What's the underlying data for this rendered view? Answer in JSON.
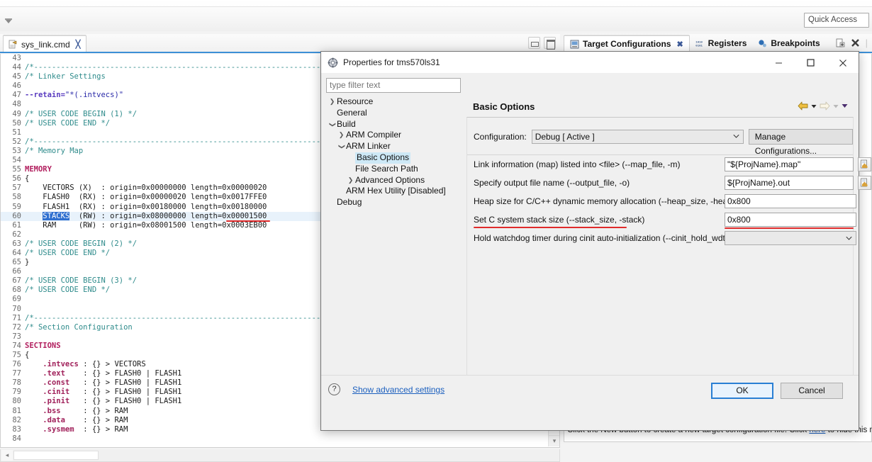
{
  "topbar": {
    "quick_access": "Quick Access",
    "menu_arrow_icon": "toolbar-overflow-icon"
  },
  "editor": {
    "tab": {
      "label": "sys_link.cmd",
      "icon": "linker-script-file-icon",
      "close_icon": "close-tab-icon"
    },
    "minimize_icon": "minimize-icon",
    "maximize_icon": "maximize-icon",
    "first_line_number": 43,
    "lines": [
      {
        "n": 43,
        "tokens": []
      },
      {
        "n": 44,
        "tokens": [
          {
            "t": "/*",
            "c": "c-comment"
          },
          {
            "t": "--------------------------------------------------------------------------------",
            "c": "dashline"
          }
        ]
      },
      {
        "n": 45,
        "tokens": [
          {
            "t": "/* Linker Settings",
            "c": "c-comment"
          }
        ]
      },
      {
        "n": 46,
        "tokens": []
      },
      {
        "n": 47,
        "tokens": [
          {
            "t": "--retain=",
            "c": "c-pre"
          },
          {
            "t": "\"*(.intvecs)\"",
            "c": "c-str"
          }
        ]
      },
      {
        "n": 48,
        "tokens": []
      },
      {
        "n": 49,
        "tokens": [
          {
            "t": "/* USER CODE BEGIN (1) */",
            "c": "c-comment"
          }
        ]
      },
      {
        "n": 50,
        "tokens": [
          {
            "t": "/* USER CODE END */",
            "c": "c-comment"
          }
        ]
      },
      {
        "n": 51,
        "tokens": []
      },
      {
        "n": 52,
        "tokens": [
          {
            "t": "/*",
            "c": "c-comment"
          },
          {
            "t": "--------------------------------------------------------------------------------",
            "c": "dashline"
          }
        ]
      },
      {
        "n": 53,
        "tokens": [
          {
            "t": "/* Memory Map",
            "c": "c-comment"
          }
        ]
      },
      {
        "n": 54,
        "tokens": []
      },
      {
        "n": 55,
        "tokens": [
          {
            "t": "MEMORY",
            "c": "c-keyword"
          }
        ]
      },
      {
        "n": 56,
        "tokens": [
          {
            "t": "{",
            "c": "c-plain"
          }
        ]
      },
      {
        "n": 57,
        "tokens": [
          {
            "t": "    VECTORS (X)  : origin=0x00000000 length=0x00000020",
            "c": "c-plain"
          }
        ]
      },
      {
        "n": 58,
        "tokens": [
          {
            "t": "    FLASH0  (RX) : origin=0x00000020 length=0x0017FFE0",
            "c": "c-plain"
          }
        ]
      },
      {
        "n": 59,
        "tokens": [
          {
            "t": "    FLASH1  (RX) : origin=0x00180000 length=0x00180000",
            "c": "c-plain"
          }
        ]
      },
      {
        "n": 60,
        "current": true,
        "tokens": [
          {
            "t": "    ",
            "c": "c-plain"
          },
          {
            "t": "STACKS",
            "c": "sel"
          },
          {
            "t": "  (RW) : origin=0x08000000 length=0x00001500",
            "c": "c-plain"
          }
        ]
      },
      {
        "n": 61,
        "tokens": [
          {
            "t": "    RAM     (RW) : origin=0x08001500 length=0x0003EB00",
            "c": "c-plain"
          }
        ]
      },
      {
        "n": 62,
        "tokens": []
      },
      {
        "n": 63,
        "tokens": [
          {
            "t": "/* USER CODE BEGIN (2) */",
            "c": "c-comment"
          }
        ]
      },
      {
        "n": 64,
        "tokens": [
          {
            "t": "/* USER CODE END */",
            "c": "c-comment"
          }
        ]
      },
      {
        "n": 65,
        "tokens": [
          {
            "t": "}",
            "c": "c-plain"
          }
        ]
      },
      {
        "n": 66,
        "tokens": []
      },
      {
        "n": 67,
        "tokens": [
          {
            "t": "/* USER CODE BEGIN (3) */",
            "c": "c-comment"
          }
        ]
      },
      {
        "n": 68,
        "tokens": [
          {
            "t": "/* USER CODE END */",
            "c": "c-comment"
          }
        ]
      },
      {
        "n": 69,
        "tokens": []
      },
      {
        "n": 70,
        "tokens": []
      },
      {
        "n": 71,
        "tokens": [
          {
            "t": "/*",
            "c": "c-comment"
          },
          {
            "t": "--------------------------------------------------------------------------------",
            "c": "dashline"
          }
        ]
      },
      {
        "n": 72,
        "tokens": [
          {
            "t": "/* Section Configuration",
            "c": "c-comment"
          }
        ]
      },
      {
        "n": 73,
        "tokens": []
      },
      {
        "n": 74,
        "tokens": [
          {
            "t": "SECTIONS",
            "c": "c-keyword"
          }
        ]
      },
      {
        "n": 75,
        "tokens": [
          {
            "t": "{",
            "c": "c-plain"
          }
        ]
      },
      {
        "n": 76,
        "tokens": [
          {
            "t": "    ",
            "c": "c-plain"
          },
          {
            "t": ".intvecs",
            "c": "c-sect"
          },
          {
            "t": " : {} > VECTORS",
            "c": "c-plain"
          }
        ]
      },
      {
        "n": 77,
        "tokens": [
          {
            "t": "    ",
            "c": "c-plain"
          },
          {
            "t": ".text",
            "c": "c-sect"
          },
          {
            "t": "    : {} > FLASH0 | FLASH1",
            "c": "c-plain"
          }
        ]
      },
      {
        "n": 78,
        "tokens": [
          {
            "t": "    ",
            "c": "c-plain"
          },
          {
            "t": ".const",
            "c": "c-sect"
          },
          {
            "t": "   : {} > FLASH0 | FLASH1",
            "c": "c-plain"
          }
        ]
      },
      {
        "n": 79,
        "tokens": [
          {
            "t": "    ",
            "c": "c-plain"
          },
          {
            "t": ".cinit",
            "c": "c-sect"
          },
          {
            "t": "   : {} > FLASH0 | FLASH1",
            "c": "c-plain"
          }
        ]
      },
      {
        "n": 80,
        "tokens": [
          {
            "t": "    ",
            "c": "c-plain"
          },
          {
            "t": ".pinit",
            "c": "c-sect"
          },
          {
            "t": "   : {} > FLASH0 | FLASH1",
            "c": "c-plain"
          }
        ]
      },
      {
        "n": 81,
        "tokens": [
          {
            "t": "    ",
            "c": "c-plain"
          },
          {
            "t": ".bss",
            "c": "c-sect"
          },
          {
            "t": "     : {} > RAM",
            "c": "c-plain"
          }
        ]
      },
      {
        "n": 82,
        "tokens": [
          {
            "t": "    ",
            "c": "c-plain"
          },
          {
            "t": ".data",
            "c": "c-sect"
          },
          {
            "t": "    : {} > RAM",
            "c": "c-plain"
          }
        ]
      },
      {
        "n": 83,
        "tokens": [
          {
            "t": "    ",
            "c": "c-plain"
          },
          {
            "t": ".sysmem",
            "c": "c-sect"
          },
          {
            "t": "  : {} > RAM",
            "c": "c-plain"
          }
        ]
      },
      {
        "n": 84,
        "tokens": []
      }
    ]
  },
  "views": {
    "tabs": [
      {
        "label": "Target Configurations",
        "icon": "target-config-icon",
        "active": true,
        "closable": true
      },
      {
        "label": "Registers",
        "icon": "registers-icon",
        "active": false,
        "closable": false
      },
      {
        "label": "Breakpoints",
        "icon": "breakpoints-icon",
        "active": false,
        "closable": false
      }
    ],
    "new_icon": "new-target-config-icon",
    "delete_icon": "delete-icon",
    "close_tab_icon": "close-tab-icon",
    "status_text_before": "Click the New button to create a new target configuration file. Click ",
    "status_link": "here",
    "status_text_after": " to hide this me"
  },
  "dialog": {
    "icon": "properties-dialog-icon",
    "title": "Properties for tms570ls31",
    "window_buttons": {
      "minimize": "—",
      "maximize": "☐",
      "close": "✕"
    },
    "filter_placeholder": "type filter text",
    "tree": [
      {
        "label": "Resource",
        "indent": 0,
        "twisty": "collapsed",
        "selected": false
      },
      {
        "label": "General",
        "indent": 0,
        "twisty": "none",
        "selected": false
      },
      {
        "label": "Build",
        "indent": 0,
        "twisty": "expanded",
        "selected": false
      },
      {
        "label": "ARM Compiler",
        "indent": 1,
        "twisty": "collapsed",
        "selected": false
      },
      {
        "label": "ARM Linker",
        "indent": 1,
        "twisty": "expanded",
        "selected": false
      },
      {
        "label": "Basic Options",
        "indent": 2,
        "twisty": "none",
        "selected": true
      },
      {
        "label": "File Search Path",
        "indent": 2,
        "twisty": "none",
        "selected": false
      },
      {
        "label": "Advanced Options",
        "indent": 2,
        "twisty": "collapsed",
        "selected": false
      },
      {
        "label": "ARM Hex Utility  [Disabled]",
        "indent": 1,
        "twisty": "none",
        "selected": false
      },
      {
        "label": "Debug",
        "indent": 0,
        "twisty": "none",
        "selected": false
      }
    ],
    "page_title": "Basic Options",
    "page_nav": {
      "back_icon": "back-arrow-icon",
      "back_menu_icon": "chevron-down-icon",
      "forward_icon": "forward-arrow-icon",
      "forward_menu_icon": "chevron-down-icon",
      "more_icon": "chevron-down-icon"
    },
    "configuration": {
      "label": "Configuration:",
      "value": "Debug  [ Active ]",
      "manage_button": "Manage Configurations..."
    },
    "fields": [
      {
        "label": "Link information (map) listed into <file> (--map_file, -m)",
        "value": "\"${ProjName}.map\"",
        "type": "text",
        "browse": true,
        "name": "map-file-field",
        "underline_label": false,
        "underline_value": false
      },
      {
        "label": "Specify output file name (--output_file, -o)",
        "value": "${ProjName}.out",
        "type": "text",
        "browse": true,
        "name": "output-file-field",
        "underline_label": false,
        "underline_value": false
      },
      {
        "label": "Heap size for C/C++ dynamic memory allocation (--heap_size, -heap)",
        "value": "0x800",
        "type": "text",
        "browse": false,
        "name": "heap-size-field",
        "underline_label": false,
        "underline_value": false
      },
      {
        "label": "Set C system stack size (--stack_size, -stack)",
        "value": "0x800",
        "type": "text",
        "browse": false,
        "name": "stack-size-field",
        "underline_label": true,
        "underline_value": true
      },
      {
        "label": "Hold watchdog timer during cinit auto-initialization (--cinit_hold_wdt)",
        "value": "",
        "type": "combo",
        "browse": false,
        "name": "cinit-hold-wdt-field",
        "underline_label": false,
        "underline_value": false
      }
    ],
    "footer": {
      "help_icon": "help-icon",
      "advanced_link": "Show advanced settings",
      "ok_label": "OK",
      "cancel_label": "Cancel"
    }
  },
  "annotations": {
    "color": "#e02b2b",
    "marks": [
      {
        "name": "stacks-length-underline"
      },
      {
        "name": "stack-size-label-underline"
      },
      {
        "name": "stack-size-value-underline"
      }
    ]
  }
}
